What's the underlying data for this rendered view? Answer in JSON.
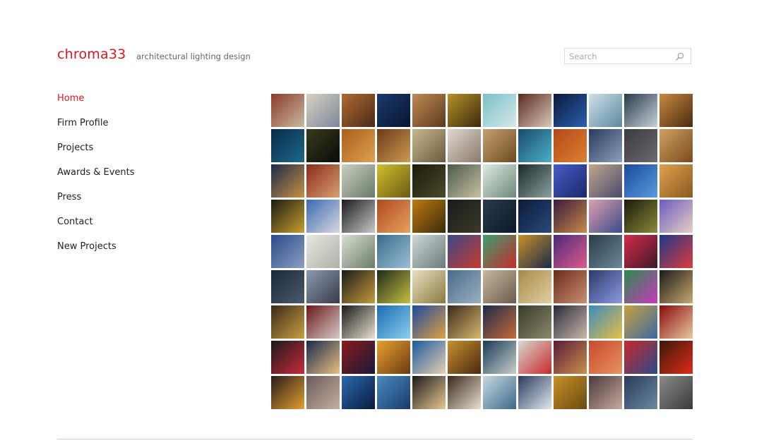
{
  "header": {
    "logo": "chroma33",
    "tagline": "architectural lighting design",
    "search_placeholder": "Search"
  },
  "nav": {
    "items": [
      {
        "label": "Home",
        "active": true
      },
      {
        "label": "Firm Profile",
        "active": false
      },
      {
        "label": "Projects",
        "active": false
      },
      {
        "label": "Awards & Events",
        "active": false
      },
      {
        "label": "Press",
        "active": false
      },
      {
        "label": "Contact",
        "active": false
      },
      {
        "label": "New Projects",
        "active": false
      }
    ]
  },
  "colors": {
    "brand_red": "#e0141e",
    "text": "#222222",
    "muted": "#666666"
  },
  "gallery": {
    "thumbs": [
      [
        "#8a3b2a",
        "#c9b9a0"
      ],
      [
        "#d8d0c0",
        "#7a8a9a"
      ],
      [
        "#b06a30",
        "#4a2a1a"
      ],
      [
        "#1a3a6a",
        "#0a1530"
      ],
      [
        "#c08a50",
        "#5a3a20"
      ],
      [
        "#b8902a",
        "#3a2a0a"
      ],
      [
        "#7ac0c8",
        "#d8e8e8"
      ],
      [
        "#5a2a20",
        "#d8c8b8"
      ],
      [
        "#0a1a3a",
        "#2a60b0"
      ],
      [
        "#d0e0e8",
        "#5a8aa0"
      ],
      [
        "#2a3a4a",
        "#c8d0d8"
      ],
      [
        "#c88a40",
        "#4a2a10"
      ],
      [
        "#0a2a4a",
        "#1a6a8a"
      ],
      [
        "#3a3a1a",
        "#0a0a0a"
      ],
      [
        "#a8601a",
        "#e0a050"
      ],
      [
        "#6a3a1a",
        "#d09a50"
      ],
      [
        "#c8b890",
        "#6a5a3a"
      ],
      [
        "#e0d8d0",
        "#8a7a6a"
      ],
      [
        "#c8a070",
        "#6a4a20"
      ],
      [
        "#1a4a6a",
        "#4ab0c8"
      ],
      [
        "#b04a1a",
        "#e08030"
      ],
      [
        "#2a3a5a",
        "#8aa0c0"
      ],
      [
        "#3a3a40",
        "#6a6a70"
      ],
      [
        "#d0a060",
        "#7a4a20"
      ],
      [
        "#1a2a4a",
        "#c89040"
      ],
      [
        "#8a2a1a",
        "#d8a070"
      ],
      [
        "#c8d0c0",
        "#6a7a6a"
      ],
      [
        "#d0c030",
        "#6a5a10"
      ],
      [
        "#1a1a0a",
        "#4a4a2a"
      ],
      [
        "#4a5a4a",
        "#c8c0a0"
      ],
      [
        "#e0e8e0",
        "#6a8a7a"
      ],
      [
        "#1a2a2a",
        "#8aa0a0"
      ],
      [
        "#4a5ac8",
        "#1a2a6a"
      ],
      [
        "#c0a890",
        "#4a4a6a"
      ],
      [
        "#1a4a9a",
        "#5a9ae0"
      ],
      [
        "#e0a050",
        "#8a5a20"
      ],
      [
        "#1a1a10",
        "#c8a030"
      ],
      [
        "#3a6ab0",
        "#d8d8e0"
      ],
      [
        "#1a1a1a",
        "#c8c8c8"
      ],
      [
        "#b04a20",
        "#e8a060"
      ],
      [
        "#c07a10",
        "#3a2a0a"
      ],
      [
        "#1a1a1a",
        "#3a3a2a"
      ],
      [
        "#2a3a4a",
        "#0a1a2a"
      ],
      [
        "#0a1a3a",
        "#2a4a7a"
      ],
      [
        "#3a1a3a",
        "#c88a4a"
      ],
      [
        "#e0a0b0",
        "#3a4a8a"
      ],
      [
        "#1a1a0a",
        "#8a8a3a"
      ],
      [
        "#6a5ac0",
        "#e8d0c0"
      ],
      [
        "#2a4a8a",
        "#8aa0c0"
      ],
      [
        "#e8e8e0",
        "#b0b0a8"
      ],
      [
        "#d8e0d0",
        "#6a7a6a"
      ],
      [
        "#3a6a8a",
        "#9ac0d8"
      ],
      [
        "#d0d8d8",
        "#6a7a7a"
      ],
      [
        "#3a4a8a",
        "#c83a2a"
      ],
      [
        "#3aa070",
        "#c82a2a"
      ],
      [
        "#c8902a",
        "#1a2a4a"
      ],
      [
        "#4a2a7a",
        "#e05a8a"
      ],
      [
        "#2a3a4a",
        "#6a8a9a"
      ],
      [
        "#d82a4a",
        "#3a1a2a"
      ],
      [
        "#1a3a8a",
        "#e03a3a"
      ],
      [
        "#1a2a3a",
        "#4a5a6a"
      ],
      [
        "#8a9ab0",
        "#3a3a4a"
      ],
      [
        "#1a1a1a",
        "#c89a3a"
      ],
      [
        "#1a2a1a",
        "#c8c040"
      ],
      [
        "#e8e0c0",
        "#8a7a40"
      ],
      [
        "#4a6a8a",
        "#9ab0c0"
      ],
      [
        "#c8b8a0",
        "#6a5a4a"
      ],
      [
        "#a8884a",
        "#e0d0a0"
      ],
      [
        "#6a2a1a",
        "#c89070"
      ],
      [
        "#2a3a6a",
        "#8a9ae0"
      ],
      [
        "#2a8a4a",
        "#c83ac0"
      ],
      [
        "#1a1a1a",
        "#c8a870"
      ],
      [
        "#3a2a1a",
        "#c8a040"
      ],
      [
        "#6a1a1a",
        "#d8c8c8"
      ],
      [
        "#1a1a1a",
        "#e8e0d0"
      ],
      [
        "#1a6ab0",
        "#8ad0f0"
      ],
      [
        "#1a4aa0",
        "#e0a040"
      ],
      [
        "#3a2a1a",
        "#d8b870"
      ],
      [
        "#1a2a4a",
        "#c86a3a"
      ],
      [
        "#3a3a2a",
        "#8a8a6a"
      ],
      [
        "#2a2a3a",
        "#c8b8a8"
      ],
      [
        "#3a8ac0",
        "#e8c040"
      ],
      [
        "#c8a040",
        "#3a6aa0"
      ],
      [
        "#8a0a0a",
        "#e8c8a0"
      ],
      [
        "#1a1a1a",
        "#c82a3a"
      ],
      [
        "#1a2a4a",
        "#e8c080"
      ],
      [
        "#8a1a1a",
        "#1a1a3a"
      ],
      [
        "#e8a030",
        "#6a3a10"
      ],
      [
        "#1a5aa0",
        "#e8d0b0"
      ],
      [
        "#c89030",
        "#4a2a10"
      ],
      [
        "#1a3a5a",
        "#c8d0c8"
      ],
      [
        "#d8d8d0",
        "#c82a2a"
      ],
      [
        "#5a1a3a",
        "#c8904a"
      ],
      [
        "#c84a2a",
        "#e89060"
      ],
      [
        "#c82a2a",
        "#2a4a8a"
      ],
      [
        "#3a1a0a",
        "#e02a1a"
      ],
      [
        "#2a1a1a",
        "#e0a030"
      ],
      [
        "#6a5a5a",
        "#c8b0a0"
      ],
      [
        "#2a6ab0",
        "#0a1a3a"
      ],
      [
        "#4a8ac0",
        "#1a3a6a"
      ],
      [
        "#1a1a1a",
        "#e8c890"
      ],
      [
        "#3a2a1a",
        "#e8e0d0"
      ],
      [
        "#c8d8e0",
        "#3a6a8a"
      ],
      [
        "#2a3a5a",
        "#e0e8f0"
      ],
      [
        "#c8902a",
        "#6a4a10"
      ],
      [
        "#4a3a3a",
        "#c8a8a0"
      ],
      [
        "#2a3a5a",
        "#6a8aa0"
      ],
      [
        "#8a8a8a",
        "#3a3a3a"
      ]
    ]
  }
}
